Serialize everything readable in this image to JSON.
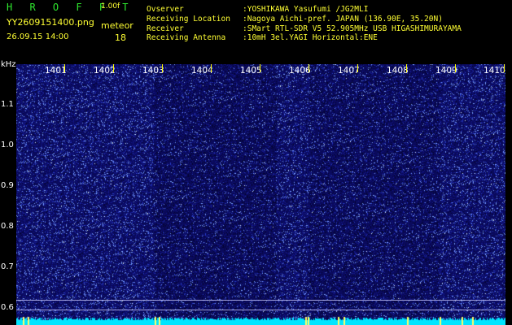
{
  "header": {
    "title": "H R O F F T",
    "version": "1.00f",
    "filename": "YY2609151400.png",
    "meteor_label": "meteor",
    "datetime": "26.09.15 14:00",
    "meteor_count": "18"
  },
  "info": [
    {
      "label": "Ovserver",
      "value": ":YOSHIKAWA Yasufumi /JG2MLI"
    },
    {
      "label": "Receiving Location",
      "value": ":Nagoya Aichi-pref. JAPAN (136.90E, 35.20N)"
    },
    {
      "label": "Receiver",
      "value": ":SMart RTL-SDR V5 52.905MHz USB HIGASHIMURAYAMA"
    },
    {
      "label": "Receiving Antenna",
      "value": ":10mH 3el.YAGI Horizontal:ENE"
    }
  ],
  "y_axis": {
    "unit": "kHz",
    "labels": [
      "1.1",
      "1.0",
      "0.9",
      "0.8",
      "0.7",
      "0.6"
    ]
  },
  "x_axis": {
    "labels": [
      "1401",
      "1402",
      "1403",
      "1404",
      "1405",
      "1406",
      "1407",
      "1408",
      "1409",
      "1410"
    ]
  },
  "colors": {
    "background": "#000000",
    "spectrogram_base": "#0a0a5c",
    "header_green": "#2ee82e",
    "header_yellow": "#ffff33",
    "noise_floor": "#00e5ff"
  }
}
